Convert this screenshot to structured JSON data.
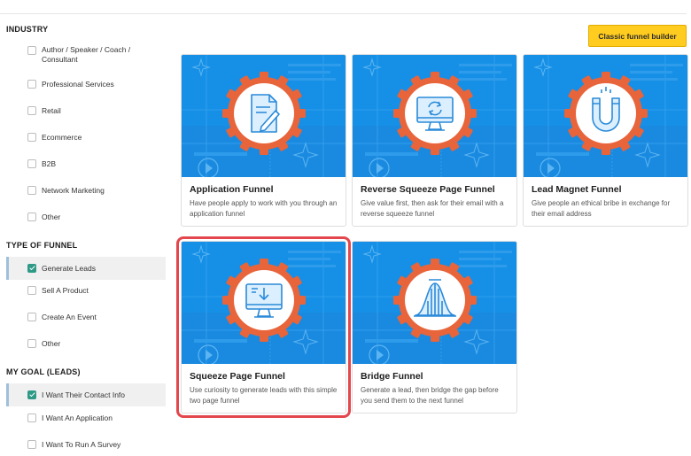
{
  "sidebar": {
    "industry": {
      "title": "INDUSTRY",
      "options": [
        {
          "label": "Author / Speaker / Coach / Consultant",
          "checked": false
        },
        {
          "label": "Professional Services",
          "checked": false
        },
        {
          "label": "Retail",
          "checked": false
        },
        {
          "label": "Ecommerce",
          "checked": false
        },
        {
          "label": "B2B",
          "checked": false
        },
        {
          "label": "Network Marketing",
          "checked": false
        },
        {
          "label": "Other",
          "checked": false
        }
      ]
    },
    "type_of_funnel": {
      "title": "TYPE OF FUNNEL",
      "options": [
        {
          "label": "Generate Leads",
          "checked": true
        },
        {
          "label": "Sell A Product",
          "checked": false
        },
        {
          "label": "Create An Event",
          "checked": false
        },
        {
          "label": "Other",
          "checked": false
        }
      ]
    },
    "goal": {
      "title": "MY GOAL (LEADS)",
      "options": [
        {
          "label": "I Want Their Contact Info",
          "checked": true
        },
        {
          "label": "I Want An Application",
          "checked": false
        },
        {
          "label": "I Want To Run A Survey",
          "checked": false
        }
      ]
    }
  },
  "classic_button": {
    "label": "Classic funnel builder"
  },
  "cards": [
    {
      "title": "Application Funnel",
      "description": "Have people apply to work with you through an application funnel",
      "icon": "document-pen-icon"
    },
    {
      "title": "Reverse Squeeze Page Funnel",
      "description": "Give value first, then ask for their email with a reverse squeeze funnel",
      "icon": "monitor-refresh-icon"
    },
    {
      "title": "Lead Magnet Funnel",
      "description": "Give people an ethical bribe in exchange for their email address",
      "icon": "magnet-icon"
    },
    {
      "title": "Squeeze Page Funnel",
      "description": "Use curiosity to generate leads with this simple two page funnel",
      "icon": "monitor-download-icon",
      "highlighted": true
    },
    {
      "title": "Bridge Funnel",
      "description": "Generate a lead, then bridge the gap before you send them to the next funnel",
      "icon": "bell-curve-icon"
    }
  ],
  "colors": {
    "card_bg": "#1590e6",
    "accent_orange": "#e8643a",
    "button_yellow": "#ffcc1f",
    "check_green": "#2e9a86",
    "highlight_red": "#e3474d"
  }
}
